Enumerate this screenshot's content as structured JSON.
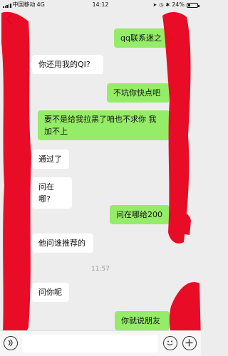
{
  "status_bar": {
    "carrier": "中国移动",
    "network": "4G",
    "time": "14:12",
    "battery": "24%",
    "battery_level": 0.24
  },
  "nav": {
    "back_icon": "chevron-left-icon",
    "title": ""
  },
  "messages": [
    {
      "side": "out",
      "text": "qq联系迷之"
    },
    {
      "side": "in",
      "text": "你还用我的QI?"
    },
    {
      "side": "out",
      "text": "不坑你快点吧"
    },
    {
      "side": "out",
      "text": "要不是给我拉黑了咱也不求你 我加不上"
    },
    {
      "side": "in",
      "text": "通过了"
    },
    {
      "side": "in",
      "text": "问在哪?"
    },
    {
      "side": "out",
      "text": "问在哪给200"
    },
    {
      "side": "in",
      "text": "他问谁推荐的"
    },
    {
      "side": "time",
      "text": "11:57"
    },
    {
      "side": "in",
      "text": "问你呢"
    },
    {
      "side": "out",
      "text": "你就说朋友"
    }
  ],
  "input_bar": {
    "voice_icon": "voice-icon",
    "input_value": "",
    "emoji_icon": "emoji-icon",
    "plus_icon": "plus-icon"
  },
  "colors": {
    "background": "#ededed",
    "incoming_bubble": "#ffffff",
    "outgoing_bubble": "#95ec69",
    "redaction": "#e8001c"
  }
}
